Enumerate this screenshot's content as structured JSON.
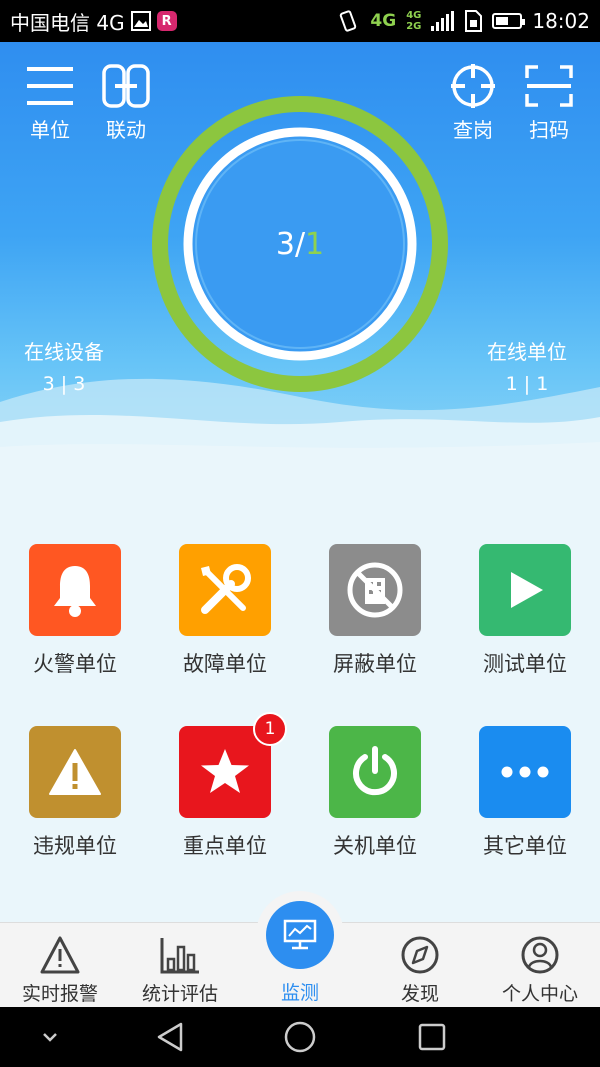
{
  "status_bar": {
    "carrier": "中国电信 4G",
    "network": "4G",
    "network_small_top": "4G",
    "network_small_bottom": "2G",
    "time": "18:02"
  },
  "header": {
    "left_buttons": [
      {
        "label": "单位",
        "icon": "menu-icon"
      },
      {
        "label": "联动",
        "icon": "link-icon"
      }
    ],
    "right_buttons": [
      {
        "label": "查岗",
        "icon": "crosshair-icon"
      },
      {
        "label": "扫码",
        "icon": "scan-icon"
      }
    ],
    "ring": {
      "online": "3",
      "separator": "/",
      "total": "1"
    },
    "online_devices": {
      "label": "在线设备",
      "value": "3 | 3"
    },
    "online_units": {
      "label": "在线单位",
      "value": "1 | 1"
    }
  },
  "categories": [
    {
      "label": "火警单位",
      "icon": "bell-icon",
      "color": "#ff5722"
    },
    {
      "label": "故障单位",
      "icon": "tools-icon",
      "color": "#ffa000"
    },
    {
      "label": "屏蔽单位",
      "icon": "blocked-building-icon",
      "color": "#8c8c8c"
    },
    {
      "label": "测试单位",
      "icon": "play-icon",
      "color": "#35b971"
    },
    {
      "label": "违规单位",
      "icon": "warning-icon",
      "color": "#c0902f"
    },
    {
      "label": "重点单位",
      "icon": "star-icon",
      "color": "#e8161d",
      "badge": "1"
    },
    {
      "label": "关机单位",
      "icon": "power-icon",
      "color": "#4cb648"
    },
    {
      "label": "其它单位",
      "icon": "more-icon",
      "color": "#1a8cf0"
    }
  ],
  "bottom_nav": {
    "items": [
      {
        "label": "实时报警",
        "icon": "alarm-icon"
      },
      {
        "label": "统计评估",
        "icon": "chart-icon"
      },
      {
        "label": "监测",
        "icon": "monitor-icon",
        "active": true
      },
      {
        "label": "发现",
        "icon": "compass-icon"
      },
      {
        "label": "个人中心",
        "icon": "user-icon"
      }
    ],
    "active_color": "#2d8ef0"
  },
  "colors": {
    "ring_outer": "#8cc63f",
    "hero_blue": "#2f8ef0"
  }
}
